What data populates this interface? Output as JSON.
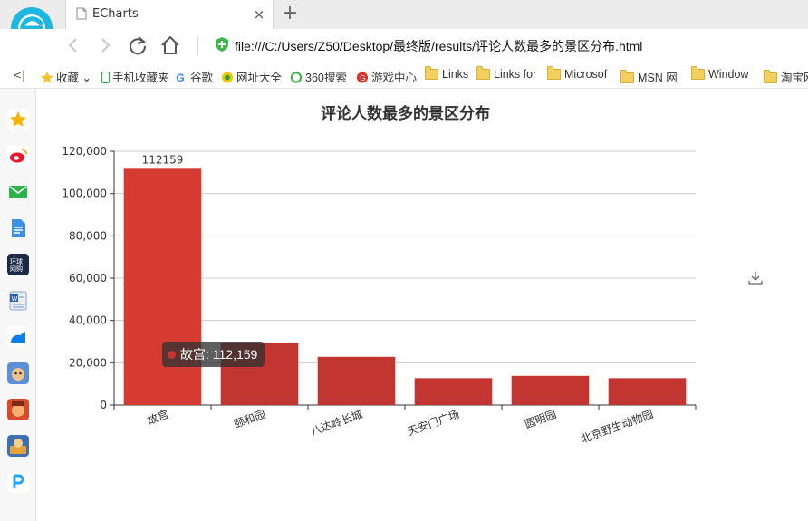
{
  "browser": {
    "tab_title": "ECharts",
    "tab_close": "×",
    "new_tab": "+",
    "url": "file:///C:/Users/Z50/Desktop/最终版/results/评论人数最多的景区分布.html"
  },
  "bookmarks": {
    "collapse": "<|",
    "items": [
      {
        "label": "收藏",
        "icon": "star-icon"
      },
      {
        "label": "手机收藏夹",
        "icon": "phone-icon"
      },
      {
        "label": "谷歌",
        "icon": "google-icon"
      },
      {
        "label": "网址大全",
        "icon": "globe-icon"
      },
      {
        "label": "360搜索",
        "icon": "360-icon"
      },
      {
        "label": "游戏中心",
        "icon": "game-icon"
      },
      {
        "label": "Links",
        "icon": "folder-icon"
      },
      {
        "label": "Links for",
        "icon": "folder-icon"
      },
      {
        "label": "Microsof",
        "icon": "folder-icon"
      },
      {
        "label": "MSN 网",
        "icon": "folder-icon"
      },
      {
        "label": "Window",
        "icon": "folder-icon"
      },
      {
        "label": "淘宝网",
        "icon": "folder-icon"
      }
    ]
  },
  "sidebar": {
    "icons": [
      "favorites-star-icon",
      "weibo-icon",
      "mail-icon",
      "document-icon",
      "news-icon",
      "word-icon",
      "cloud-drive-icon",
      "game1-icon",
      "game2-icon",
      "game3-icon",
      "app-icon"
    ]
  },
  "colors": {
    "bar": "#c23531",
    "bar_highlight": "#d63b31",
    "axis": "#333333",
    "grid": "#cccccc"
  },
  "chart_data": {
    "type": "bar",
    "title": "评论人数最多的景区分布",
    "categories": [
      "故宫",
      "颐和园",
      "八达岭长城",
      "天安门广场",
      "圆明园",
      "北京野生动物园"
    ],
    "values": [
      112159,
      29500,
      22800,
      12700,
      13800,
      12700
    ],
    "data_label": "112159",
    "ylim": [
      0,
      120000
    ],
    "yticks": [
      "0",
      "20,000",
      "40,000",
      "60,000",
      "80,000",
      "100,000",
      "120,000"
    ],
    "grid": true,
    "tooltip": {
      "text": "故宫: 112,159"
    }
  }
}
